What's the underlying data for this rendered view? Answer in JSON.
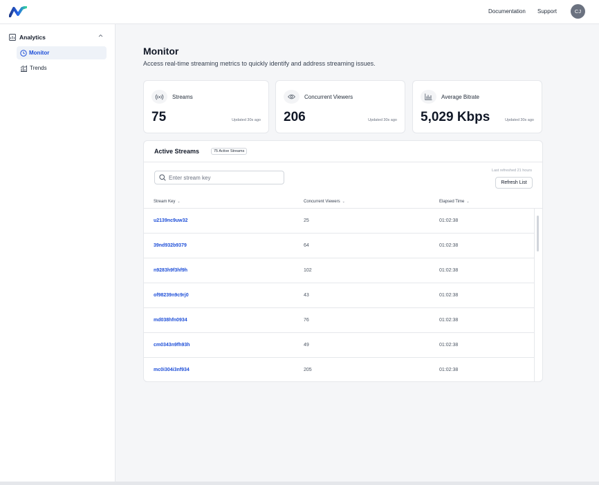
{
  "header": {
    "logo_icon": "brand-logo-icon",
    "links": [
      "Documentation",
      "Support"
    ],
    "avatar_initials": "CJ"
  },
  "sidebar": {
    "group": {
      "label": "Analytics",
      "icon": "analytics-icon",
      "expanded": true
    },
    "items": [
      {
        "label": "Monitor",
        "icon": "clock-icon",
        "active": true
      },
      {
        "label": "Trends",
        "icon": "trends-icon",
        "active": false
      }
    ]
  },
  "page": {
    "title": "Monitor",
    "subtitle": "Access real-time streaming metrics to quickly identify and address streaming issues."
  },
  "stats": [
    {
      "name": "Streams",
      "value": "75",
      "updated": "Updated 30s ago",
      "icon": "broadcast-icon"
    },
    {
      "name": "Concurrent Viewers",
      "value": "206",
      "updated": "Updated 30s ago",
      "icon": "eye-icon"
    },
    {
      "name": "Average Bitrate",
      "value": "5,029 Kbps",
      "updated": "Updated 30s ago",
      "icon": "bar-chart-icon"
    }
  ],
  "active_streams": {
    "title": "Active Streams",
    "badge": "75 Active Streams",
    "search_placeholder": "Enter stream key",
    "last_refreshed": "Last refreshed 21 hours",
    "refresh_label": "Refresh List",
    "columns": [
      "Stream Key",
      "Concurrent Viewers",
      "Elapsed Time"
    ],
    "rows": [
      {
        "key": "u2139nc9uw32",
        "viewers": "25",
        "elapsed": "01:02:38"
      },
      {
        "key": "39nd932b9379",
        "viewers": "64",
        "elapsed": "01:02:38"
      },
      {
        "key": "n9283h9f3hf9h",
        "viewers": "102",
        "elapsed": "01:02:38"
      },
      {
        "key": "of98239n9c9rj0",
        "viewers": "43",
        "elapsed": "01:02:38"
      },
      {
        "key": "md038hfn0934",
        "viewers": "76",
        "elapsed": "01:02:38"
      },
      {
        "key": "cm0343n9fh93h",
        "viewers": "49",
        "elapsed": "01:02:38"
      },
      {
        "key": "mc0i304i3nf934",
        "viewers": "205",
        "elapsed": "01:02:38"
      }
    ]
  },
  "colors": {
    "accent": "#1d4ed8",
    "brand_light": "#34d399",
    "brand_dark": "#1e3a8a"
  }
}
